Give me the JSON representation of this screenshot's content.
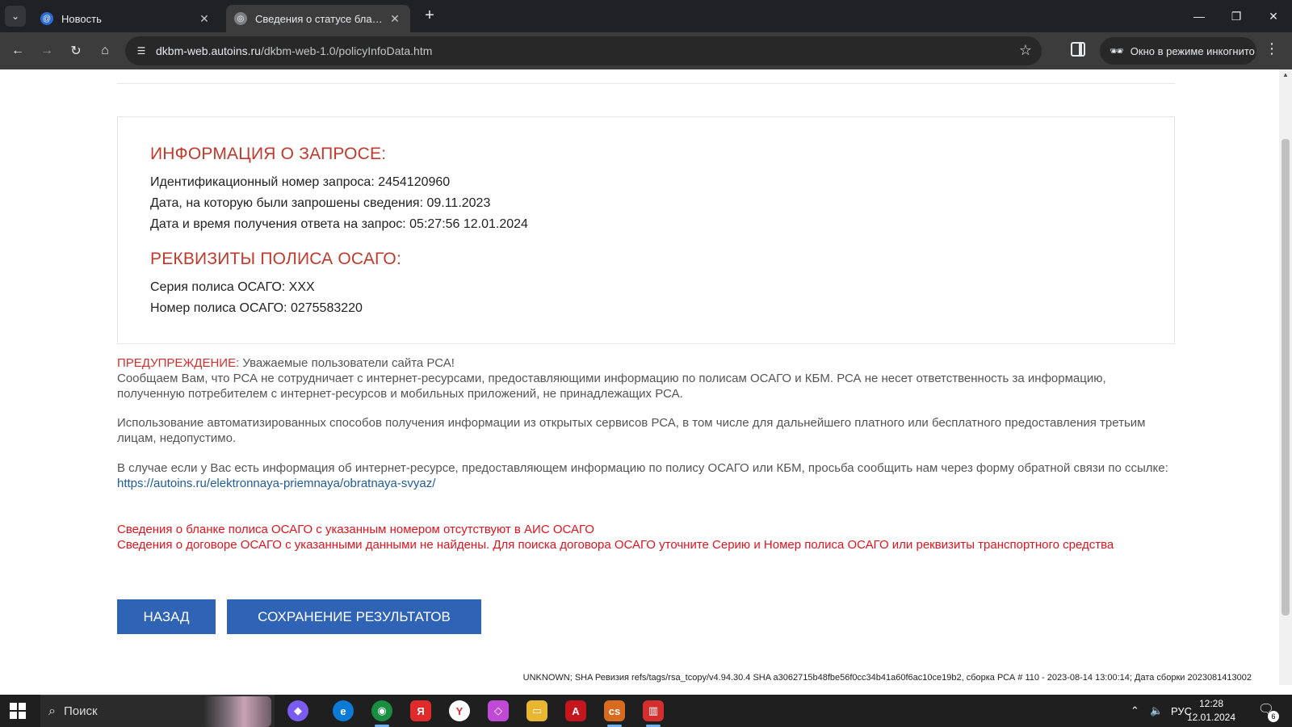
{
  "browser": {
    "tabs": [
      {
        "title": "Новость"
      },
      {
        "title": "Сведения о статусе бланков по"
      }
    ],
    "url_host": "dkbm-web.autoins.ru",
    "url_path": "/dkbm-web-1.0/policyInfoData.htm",
    "incognito_label": "Окно в режиме инкогнито"
  },
  "page": {
    "request_info_title": "ИНФОРМАЦИЯ О ЗАПРОСЕ:",
    "request_id_line": "Идентификационный номер запроса: 2454120960",
    "request_date_line": "Дата, на которую были запрошены сведения: 09.11.2023",
    "response_time_line": "Дата и время получения ответа на запрос: 05:27:56 12.01.2024",
    "policy_title": "РЕКВИЗИТЫ ПОЛИСА ОСАГО:",
    "policy_series_line": "Серия полиса ОСАГО: ХХХ",
    "policy_number_line": "Номер полиса ОСАГО: 0275583220",
    "warning_label": "ПРЕДУПРЕЖДЕНИЕ:",
    "warning_greeting": " Уважаемые пользователи сайта РСА!",
    "warning_p1": "Сообщаем Вам, что РСА не сотрудничает с интернет-ресурсами, предоставляющими информацию по полисам ОСАГО и КБМ. РСА не несет ответственность за информацию, полученную потребителем с интернет-ресурсов и мобильных приложений, не принадлежащих РСА.",
    "warning_p2": "Использование автоматизированных способов получения информации из открытых сервисов РСА, в том числе для дальнейшего платного или бесплатного предоставления третьим лицам, недопустимо.",
    "warning_p3": "В случае если у Вас есть информация об интернет-ресурсе, предоставляющем информацию по полису ОСАГО или КБМ, просьба сообщить нам через форму обратной связи по ссылке: ",
    "feedback_link": "https://autoins.ru/elektronnaya-priemnaya/obratnaya-svyaz/",
    "error_1": "Сведения о бланке полиса ОСАГО с указанным номером отсутствуют в АИС ОСАГО",
    "error_2": "Сведения о договоре ОСАГО с указанными данными не найдены. Для поиска договора ОСАГО уточните Серию и Номер полиса ОСАГО или реквизиты транспортного средства",
    "back_button": "НАЗАД",
    "save_button": "СОХРАНЕНИЕ РЕЗУЛЬТАТОВ",
    "build_info": "UNKNOWN; SHA Ревизия refs/tags/rsa_tcopy/v4.94.30.4 SHA a3062715b48fbe56f0cc34b41a60f6ac10ce19b2, сборка РСА # 110 - 2023-08-14 13:00:14; Дата сборки 2023081413002"
  },
  "taskbar": {
    "search_placeholder": "Поиск",
    "language": "РУС",
    "time": "12:28",
    "date": "12.01.2024",
    "notifications_count": "6"
  }
}
